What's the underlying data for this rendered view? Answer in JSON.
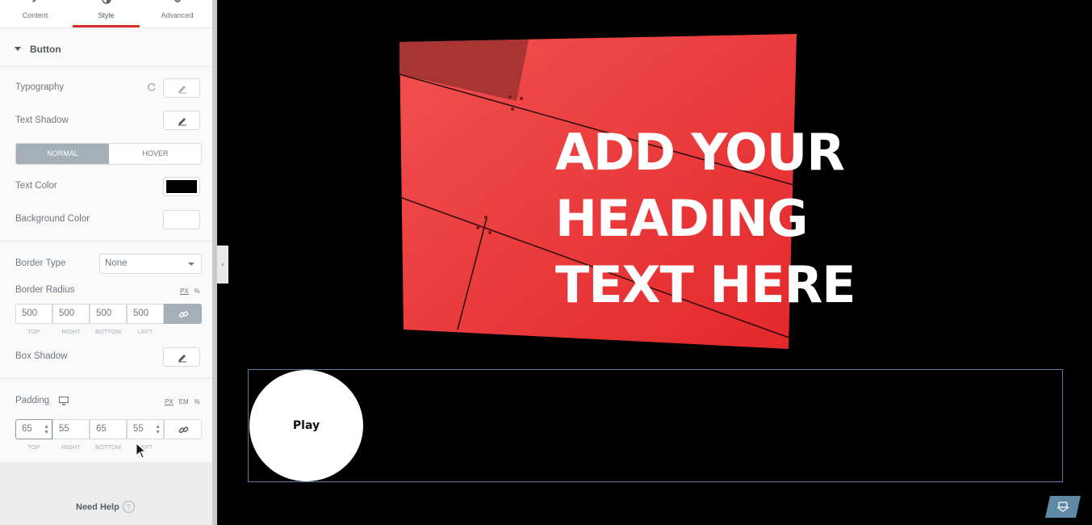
{
  "tabs": [
    {
      "label": "Content",
      "icon": "pencil-icon"
    },
    {
      "label": "Style",
      "icon": "half-circle-icon"
    },
    {
      "label": "Advanced",
      "icon": "gear-icon"
    }
  ],
  "section": {
    "title": "Button"
  },
  "controls": {
    "typography": "Typography",
    "text_shadow": "Text Shadow",
    "state_normal": "NORMAL",
    "state_hover": "HOVER",
    "text_color": "Text Color",
    "text_color_value": "#000000",
    "background_color": "Background Color",
    "border_type": "Border Type",
    "border_type_value": "None",
    "border_radius": "Border Radius",
    "border_radius_units": [
      "PX",
      "%"
    ],
    "border_radius_values": [
      "500",
      "500",
      "500",
      "500"
    ],
    "box_shadow": "Box Shadow",
    "padding": "Padding",
    "padding_units": [
      "PX",
      "EM",
      "%"
    ],
    "padding_values": [
      "65",
      "55",
      "65",
      "55"
    ],
    "dim_labels": [
      "TOP",
      "RIGHT",
      "BOTTOM",
      "LEFT"
    ]
  },
  "footer": {
    "need_help": "Need Help"
  },
  "canvas": {
    "heading_lines": [
      "ADD YOUR",
      "HEADING",
      "TEXT HERE"
    ],
    "button_label": "Play"
  },
  "colors": {
    "accent": "#d3312f",
    "hero_red": "#ee3a3a"
  }
}
